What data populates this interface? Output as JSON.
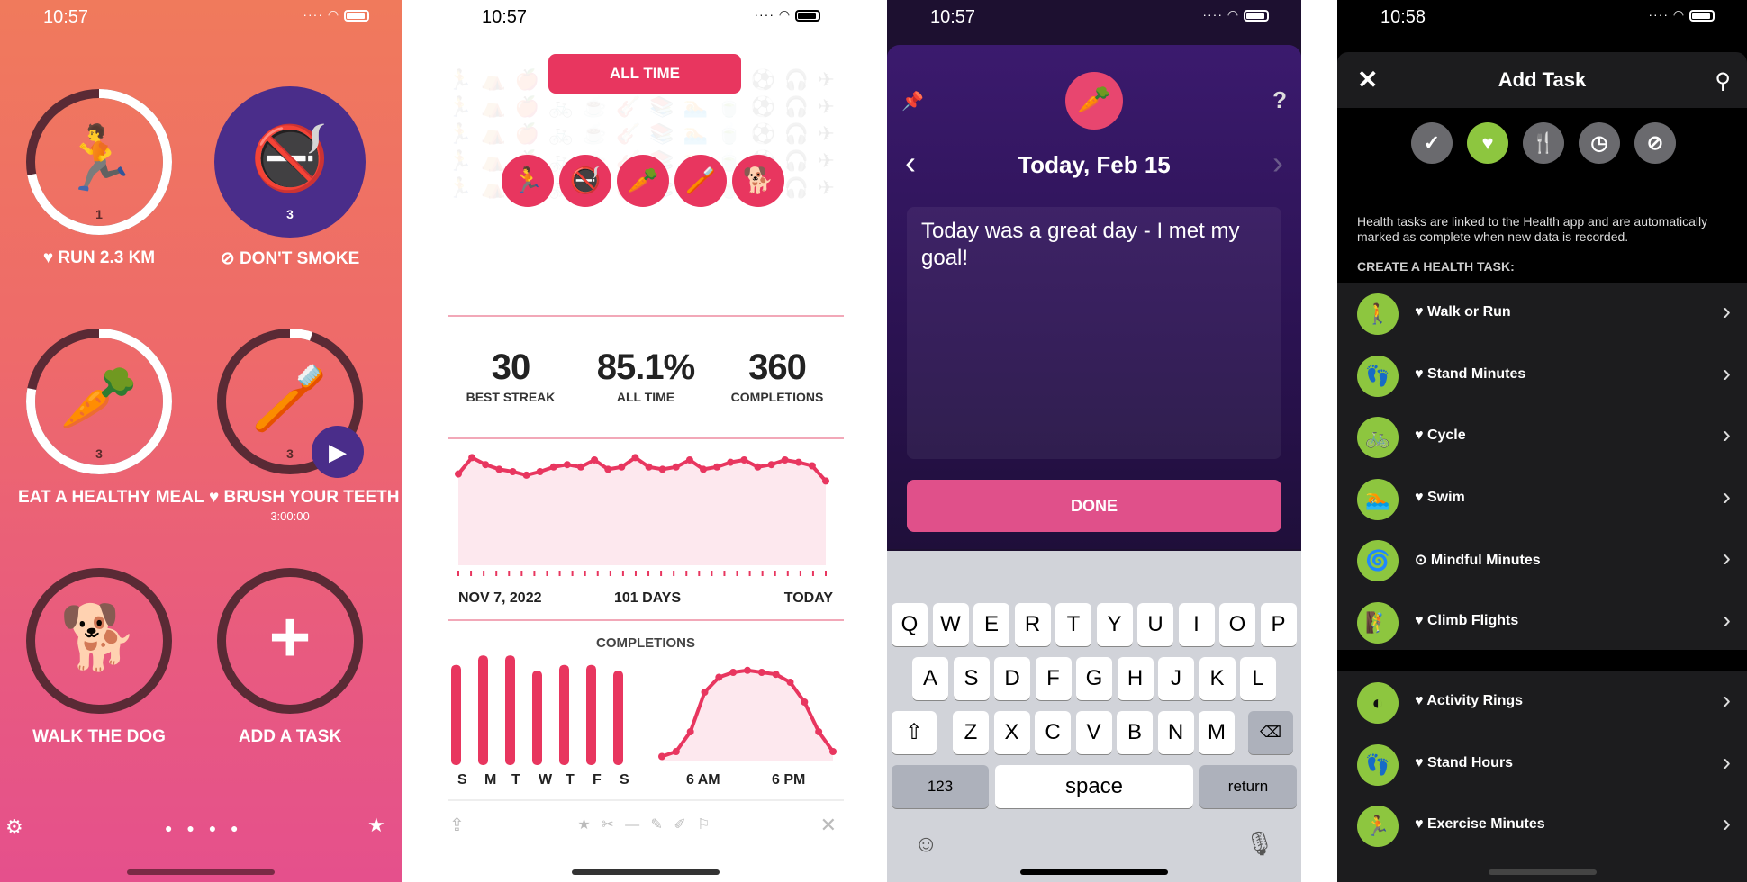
{
  "status": {
    "time1": "10:57",
    "time2": "10:57",
    "time3": "10:57",
    "time4": "10:58"
  },
  "colors": {
    "accent": "#e8365f",
    "health_green": "#8dc63f",
    "purple": "#4a2d8a"
  },
  "tasks": [
    {
      "label": "♥ RUN 2.3 KM",
      "count": "1",
      "icon": "runner-icon",
      "progress": 0.72
    },
    {
      "label": "⊘ DON'T SMOKE",
      "count": "3",
      "icon": "no-smoking-icon",
      "progress": 1.0
    },
    {
      "label": "EAT A HEALTHY MEAL",
      "count": "3",
      "icon": "carrot-icon",
      "progress": 0.78
    },
    {
      "label": "♥ BRUSH YOUR TEETH",
      "sub": "3:00:00",
      "count": "3",
      "icon": "toothbrush-icon",
      "progress": 0.05
    },
    {
      "label": "WALK THE DOG",
      "icon": "dog-icon",
      "progress": 0
    },
    {
      "label": "ADD A TASK",
      "icon": "plus-icon",
      "progress": 0
    }
  ],
  "stats": {
    "range_button": "ALL TIME",
    "items": [
      {
        "value": "30",
        "label": "BEST STREAK"
      },
      {
        "value": "85.1%",
        "label": "ALL TIME"
      },
      {
        "value": "360",
        "label": "COMPLETIONS"
      }
    ],
    "start": "NOV 7, 2022",
    "span": "101 DAYS",
    "end": "TODAY",
    "completions_label": "COMPLETIONS",
    "days": [
      "S",
      "M",
      "T",
      "W",
      "T",
      "F",
      "S"
    ],
    "hours": [
      "6 AM",
      "6 PM"
    ]
  },
  "chart_data": [
    {
      "type": "area",
      "title": "",
      "x_labels": [
        "NOV 7, 2022",
        "101 DAYS",
        "TODAY"
      ],
      "values": [
        0.78,
        0.92,
        0.86,
        0.82,
        0.8,
        0.77,
        0.8,
        0.84,
        0.86,
        0.84,
        0.9,
        0.82,
        0.84,
        0.92,
        0.84,
        0.82,
        0.84,
        0.9,
        0.82,
        0.84,
        0.88,
        0.9,
        0.84,
        0.86,
        0.9,
        0.88,
        0.85,
        0.72
      ],
      "ylim": [
        0,
        1
      ]
    },
    {
      "type": "bar",
      "title": "COMPLETIONS",
      "categories": [
        "S",
        "M",
        "T",
        "W",
        "T",
        "F",
        "S"
      ],
      "values": [
        53,
        58,
        58,
        50,
        53,
        53,
        50
      ]
    },
    {
      "type": "area",
      "title": "",
      "x_labels": [
        "6 AM",
        "6 PM"
      ],
      "values": [
        0.05,
        0.1,
        0.3,
        0.7,
        0.85,
        0.9,
        0.92,
        0.9,
        0.88,
        0.8,
        0.6,
        0.3,
        0.1
      ],
      "ylim": [
        0,
        1
      ]
    }
  ],
  "journal": {
    "date": "Today, Feb 15",
    "text": "Today was a great day - I met my goal!",
    "done": "DONE"
  },
  "keyboard": {
    "row1": [
      "Q",
      "W",
      "E",
      "R",
      "T",
      "Y",
      "U",
      "I",
      "O",
      "P"
    ],
    "row2": [
      "A",
      "S",
      "D",
      "F",
      "G",
      "H",
      "J",
      "K",
      "L"
    ],
    "row3": [
      "Z",
      "X",
      "C",
      "V",
      "B",
      "N",
      "M"
    ],
    "num": "123",
    "space": "space",
    "ret": "return"
  },
  "addtask": {
    "title": "Add Task",
    "info": "Health tasks are linked to the Health app and are automatically marked as complete when new data is recorded.",
    "section": "CREATE A HEALTH TASK:",
    "items": [
      {
        "name": "♥ Walk or Run",
        "icon": "walk-icon"
      },
      {
        "name": "♥ Stand Minutes",
        "icon": "footprints-icon"
      },
      {
        "name": "♥ Cycle",
        "icon": "bike-icon"
      },
      {
        "name": "♥ Swim",
        "icon": "swim-icon"
      },
      {
        "name": "⊙ Mindful Minutes",
        "icon": "mindful-icon"
      },
      {
        "name": "♥ Climb Flights",
        "icon": "stairs-icon"
      }
    ],
    "items2": [
      {
        "name": "♥ Activity Rings",
        "icon": "rings-icon"
      },
      {
        "name": "♥ Stand Hours",
        "icon": "footprints-icon"
      },
      {
        "name": "♥ Exercise Minutes",
        "icon": "exercise-icon"
      }
    ]
  }
}
